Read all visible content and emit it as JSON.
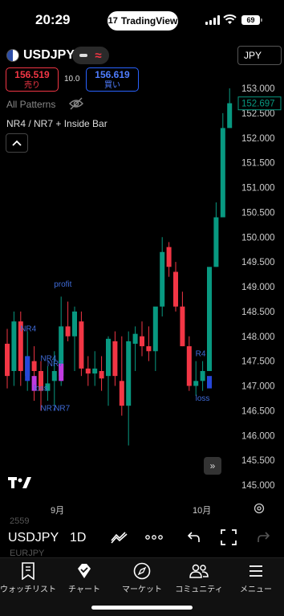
{
  "status_bar": {
    "time": "20:29",
    "app_badge": "TradingView",
    "battery": "69"
  },
  "header": {
    "symbol": "USDJPY",
    "currency": "JPY",
    "sell": {
      "price": "156.519",
      "label": "売り"
    },
    "buy": {
      "price": "156.619",
      "label": "買い"
    },
    "spread": "10.0"
  },
  "patterns": {
    "all_label": "All Patterns",
    "indicator": "NR4 / NR7 + Inside Bar"
  },
  "chart_data": {
    "type": "candlestick",
    "y_ticks": [
      "153.000",
      "152.500",
      "152.000",
      "151.500",
      "151.000",
      "150.500",
      "150.000",
      "149.500",
      "149.000",
      "148.500",
      "148.000",
      "147.500",
      "147.000",
      "146.500",
      "146.000",
      "145.500",
      "145.000"
    ],
    "ylim": [
      145.0,
      153.0
    ],
    "last_price": "152.697",
    "x_labels": [
      "9月",
      "10月"
    ],
    "candles": [
      {
        "o": 147.85,
        "h": 148.15,
        "l": 146.95,
        "c": 147.2
      },
      {
        "o": 147.3,
        "h": 148.5,
        "l": 147.0,
        "c": 148.3
      },
      {
        "o": 148.3,
        "h": 148.5,
        "l": 147.0,
        "c": 147.3
      },
      {
        "o": 147.2,
        "h": 148.1,
        "l": 146.9,
        "c": 147.6
      },
      {
        "o": 147.5,
        "h": 147.8,
        "l": 146.7,
        "c": 147.3
      },
      {
        "o": 147.3,
        "h": 147.5,
        "l": 146.5,
        "c": 146.9
      },
      {
        "o": 146.9,
        "h": 147.4,
        "l": 146.7,
        "c": 147.05
      },
      {
        "o": 147.1,
        "h": 147.7,
        "l": 146.6,
        "c": 147.3
      },
      {
        "o": 147.2,
        "h": 148.8,
        "l": 147.0,
        "c": 148.2
      },
      {
        "o": 148.2,
        "h": 148.7,
        "l": 147.9,
        "c": 148.0
      },
      {
        "o": 148.0,
        "h": 148.6,
        "l": 147.3,
        "c": 148.5
      },
      {
        "o": 148.3,
        "h": 148.5,
        "l": 147.2,
        "c": 147.35
      },
      {
        "o": 147.35,
        "h": 147.6,
        "l": 147.0,
        "c": 147.25
      },
      {
        "o": 147.25,
        "h": 147.7,
        "l": 147.0,
        "c": 147.35
      },
      {
        "o": 147.3,
        "h": 147.6,
        "l": 146.9,
        "c": 147.15
      },
      {
        "o": 147.2,
        "h": 148.0,
        "l": 146.6,
        "c": 147.95
      },
      {
        "o": 147.9,
        "h": 148.1,
        "l": 147.0,
        "c": 147.2
      },
      {
        "o": 147.1,
        "h": 148.0,
        "l": 146.4,
        "c": 146.6
      },
      {
        "o": 146.6,
        "h": 148.1,
        "l": 145.8,
        "c": 147.9
      },
      {
        "o": 147.85,
        "h": 148.2,
        "l": 147.3,
        "c": 148.05
      },
      {
        "o": 148.0,
        "h": 148.3,
        "l": 147.6,
        "c": 147.8
      },
      {
        "o": 147.8,
        "h": 148.2,
        "l": 147.5,
        "c": 147.7
      },
      {
        "o": 147.7,
        "h": 148.5,
        "l": 147.3,
        "c": 148.6
      },
      {
        "o": 148.6,
        "h": 150.0,
        "l": 148.4,
        "c": 149.7
      },
      {
        "o": 149.8,
        "h": 149.9,
        "l": 149.2,
        "c": 149.4
      },
      {
        "o": 149.3,
        "h": 149.5,
        "l": 148.5,
        "c": 148.6
      },
      {
        "o": 148.6,
        "h": 148.9,
        "l": 147.8,
        "c": 147.8
      },
      {
        "o": 147.8,
        "h": 148.0,
        "l": 146.9,
        "c": 147.0
      },
      {
        "o": 147.0,
        "h": 147.5,
        "l": 146.8,
        "c": 147.1
      },
      {
        "o": 147.1,
        "h": 147.5,
        "l": 146.9,
        "c": 147.3
      },
      {
        "o": 147.3,
        "h": 149.3,
        "l": 147.3,
        "c": 149.4
      },
      {
        "o": 149.4,
        "h": 150.7,
        "l": 149.4,
        "c": 150.4
      },
      {
        "o": 150.4,
        "h": 152.5,
        "l": 150.4,
        "c": 152.2
      },
      {
        "o": 152.2,
        "h": 153.0,
        "l": 152.2,
        "c": 152.7
      }
    ],
    "annotations": [
      {
        "text": "profit",
        "candle": 8,
        "price": 149.0
      },
      {
        "text": "NR4",
        "candle": 3,
        "price": 148.1
      },
      {
        "text": "NR4",
        "candle": 6,
        "price": 147.5
      },
      {
        "text": "NR7",
        "candle": 7,
        "price": 147.4
      },
      {
        "text": "loss",
        "candle": 5,
        "price": 146.9
      },
      {
        "text": "NR7",
        "candle": 6,
        "price": 146.5
      },
      {
        "text": "NR7",
        "candle": 8,
        "price": 146.5
      },
      {
        "text": "R4",
        "candle": 29,
        "price": 147.6
      },
      {
        "text": "loss",
        "candle": 29,
        "price": 146.7
      }
    ]
  },
  "toolbar": {
    "symbol": "USDJPY",
    "interval": "1D",
    "ghost_above": "2559",
    "ghost_below": "EURJPY"
  },
  "nav": [
    {
      "label": "ウォッチリスト",
      "icon": "watchlist-icon"
    },
    {
      "label": "チャート",
      "icon": "chart-icon"
    },
    {
      "label": "マーケット",
      "icon": "compass-icon"
    },
    {
      "label": "コミュニティ",
      "icon": "community-icon"
    },
    {
      "label": "メニュー",
      "icon": "menu-icon"
    }
  ],
  "colors": {
    "up": "#089981",
    "down": "#f23645",
    "pattern": "#3f6bd8",
    "inside_bar": "#c03be0"
  }
}
